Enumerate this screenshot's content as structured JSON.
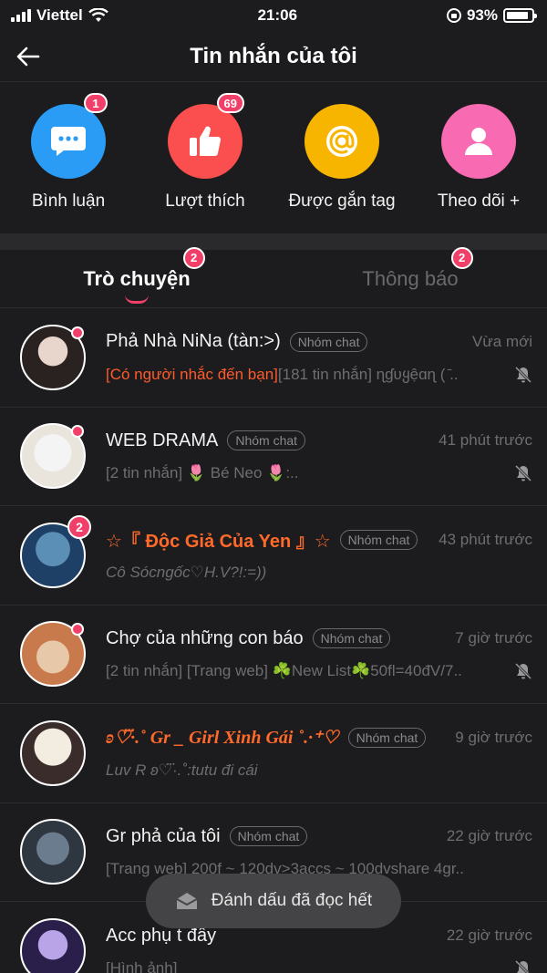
{
  "status_bar": {
    "carrier": "Viettel",
    "time": "21:06",
    "battery": "93%"
  },
  "header": {
    "title": "Tin nhắn của tôi"
  },
  "categories": [
    {
      "label": "Bình luận",
      "badge": "1",
      "color": "#2b9cf5",
      "icon": "comment-icon"
    },
    {
      "label": "Lượt thích",
      "badge": "69",
      "color": "#fb4e4e",
      "icon": "thumbs-up-icon"
    },
    {
      "label": "Được gắn tag",
      "badge": "",
      "color": "#f7b500",
      "icon": "at-icon"
    },
    {
      "label": "Theo dõi +",
      "badge": "",
      "color": "#f86ab2",
      "icon": "user-icon"
    }
  ],
  "tabs": [
    {
      "label": "Trò chuyện",
      "badge": "2",
      "active": true
    },
    {
      "label": "Thông báo",
      "badge": "2",
      "active": false
    }
  ],
  "chats": [
    {
      "name": "Phả Nhà NiNa (tàn:>)",
      "tag": "Nhóm chat",
      "time": "Vừa mới",
      "mention": "[Có người nhắc đến bạn]",
      "message": "[181 tin nhắn] ɳɠυყệɑɳ ( ̄..",
      "muted": true,
      "badge": ""
    },
    {
      "name": "WEB DRAMA",
      "tag": "Nhóm chat",
      "time": "41 phút trước",
      "mention": "",
      "message": "[2 tin nhắn] 🌷 Bé Neo 🌷:..",
      "muted": true,
      "badge": ""
    },
    {
      "name": "☆『 Độc Giả Của Yen 』☆",
      "tag": "Nhóm chat",
      "time": "43 phút trước",
      "mention": "",
      "message": "Cô Sócngốc♡H.V?!:=))",
      "muted": false,
      "badge": "2"
    },
    {
      "name": "Chợ của những con báo",
      "tag": "Nhóm chat",
      "time": "7 giờ trước",
      "mention": "",
      "message": "[2 tin nhắn] [Trang web] ☘️New List☘️50fl=40đV/7..",
      "muted": true,
      "badge": ""
    },
    {
      "name": "ʚ♡⃛·.˚ Gr _ Girl Xinh Gái ˚.·⁺♡",
      "tag": "Nhóm chat",
      "time": "9 giờ trước",
      "mention": "",
      "message": "Luv R ʚ♡⃛·.˚:tutu đi cái",
      "muted": false,
      "badge": ""
    },
    {
      "name": "Gr phả của tôi",
      "tag": "Nhóm chat",
      "time": "22 giờ trước",
      "mention": "",
      "message": "[Trang web] 200f ~ 120dv>3accs ~ 100dvshare 4gr..",
      "muted": false,
      "badge": ""
    },
    {
      "name": "Acc phụ t đấy",
      "tag": "",
      "time": "22 giờ trước",
      "mention": "",
      "message": "[Hình ảnh]",
      "muted": true,
      "badge": ""
    }
  ],
  "mark_all_read": "Đánh dấu đã đọc hết"
}
